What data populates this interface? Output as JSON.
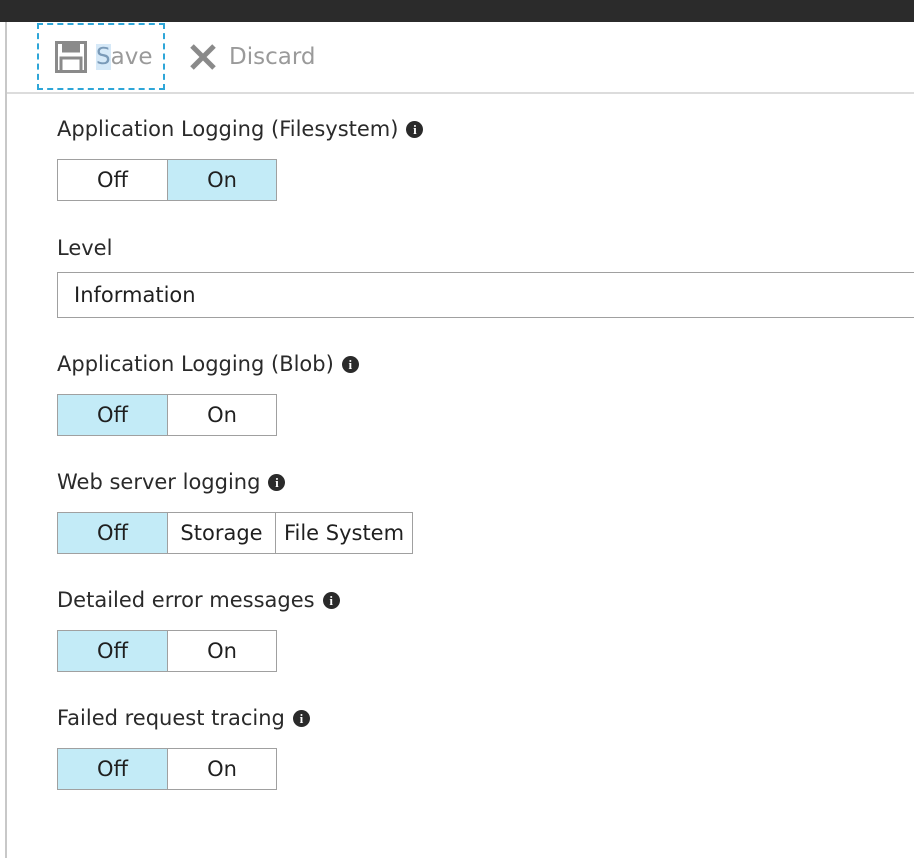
{
  "toolbar": {
    "save_first": "S",
    "save_rest": "ave",
    "discard_label": "Discard"
  },
  "app_logging_fs": {
    "label": "Application Logging (Filesystem)",
    "options": [
      "Off",
      "On"
    ],
    "selected": "On"
  },
  "level": {
    "label": "Level",
    "value": "Information"
  },
  "app_logging_blob": {
    "label": "Application Logging (Blob)",
    "options": [
      "Off",
      "On"
    ],
    "selected": "Off"
  },
  "web_server_logging": {
    "label": "Web server logging",
    "options": [
      "Off",
      "Storage",
      "File System"
    ],
    "selected": "Off"
  },
  "detailed_errors": {
    "label": "Detailed error messages",
    "options": [
      "Off",
      "On"
    ],
    "selected": "Off"
  },
  "failed_request_tracing": {
    "label": "Failed request tracing",
    "options": [
      "Off",
      "On"
    ],
    "selected": "Off"
  },
  "info_icon_glyph": "i",
  "colors": {
    "selected_option": "#c3ebf7",
    "focus_outline": "#2ea6d8",
    "top_bar": "#2b2b2b"
  }
}
